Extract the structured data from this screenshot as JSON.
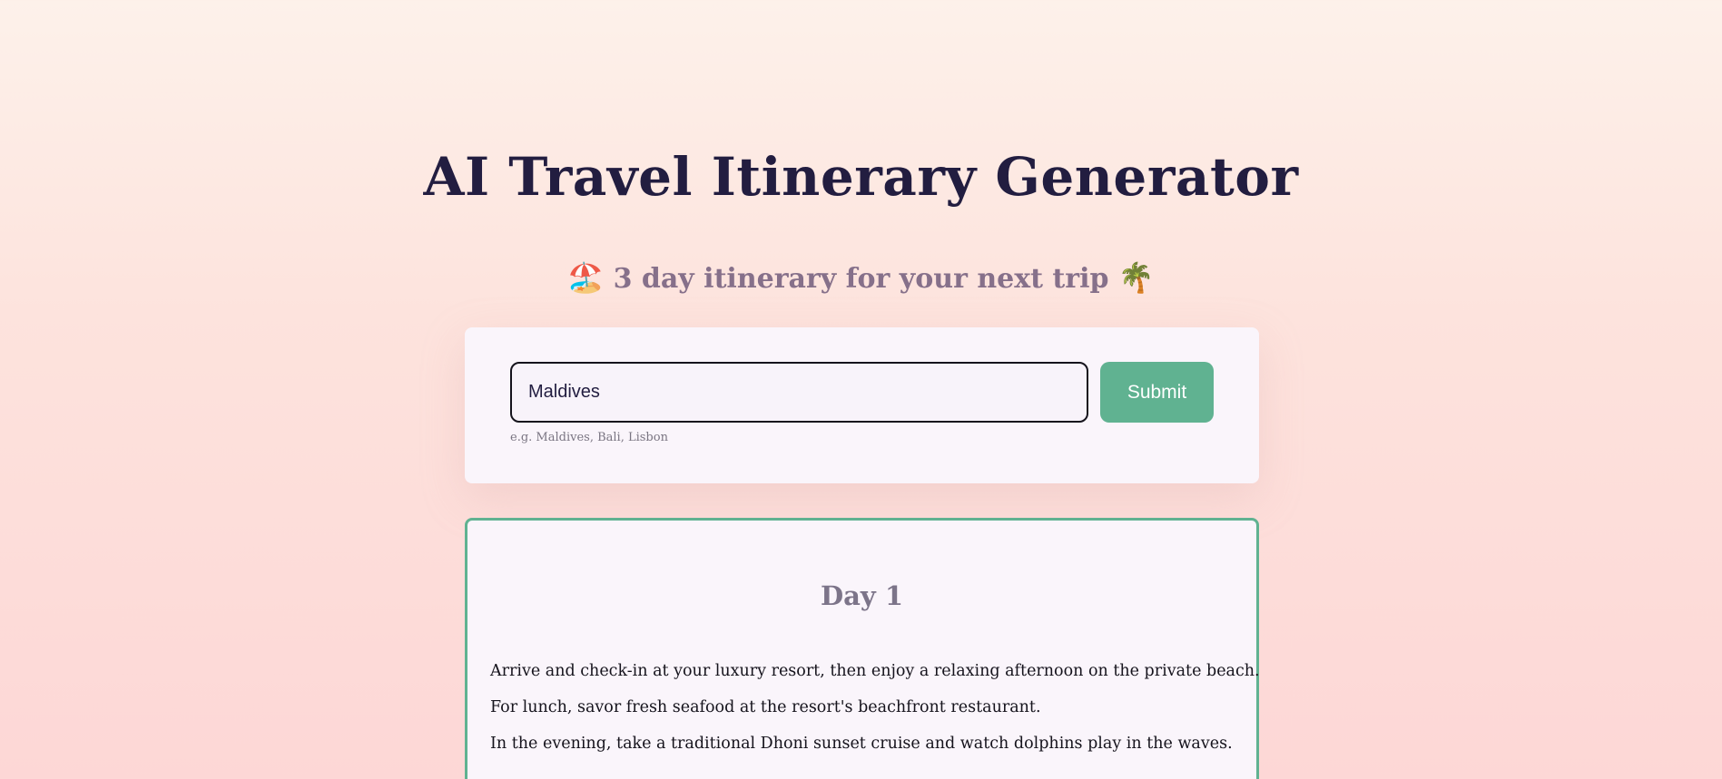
{
  "header": {
    "title": "AI Travel Itinerary Generator",
    "subtitle_text": "3 day itinerary for your next trip",
    "subtitle_emoji_left": "🏖️",
    "subtitle_emoji_right": "🌴"
  },
  "form": {
    "destination_value": "Maldives",
    "submit_label": "Submit",
    "hint": "e.g. Maldives, Bali, Lisbon"
  },
  "itinerary": {
    "day_title": "Day 1",
    "lines": [
      "Arrive and check-in at your luxury resort, then enjoy a relaxing afternoon on the private beach.",
      "For lunch, savor fresh seafood at the resort's beachfront restaurant.",
      "In the evening, take a traditional Dhoni sunset cruise and watch dolphins play in the waves."
    ]
  },
  "colors": {
    "accent": "#60b291",
    "title": "#221d40",
    "subtitle": "#86708a",
    "card_background": "#faf5fb"
  },
  "icons": {
    "left": "beach-umbrella-icon",
    "right": "palm-tree-icon"
  }
}
